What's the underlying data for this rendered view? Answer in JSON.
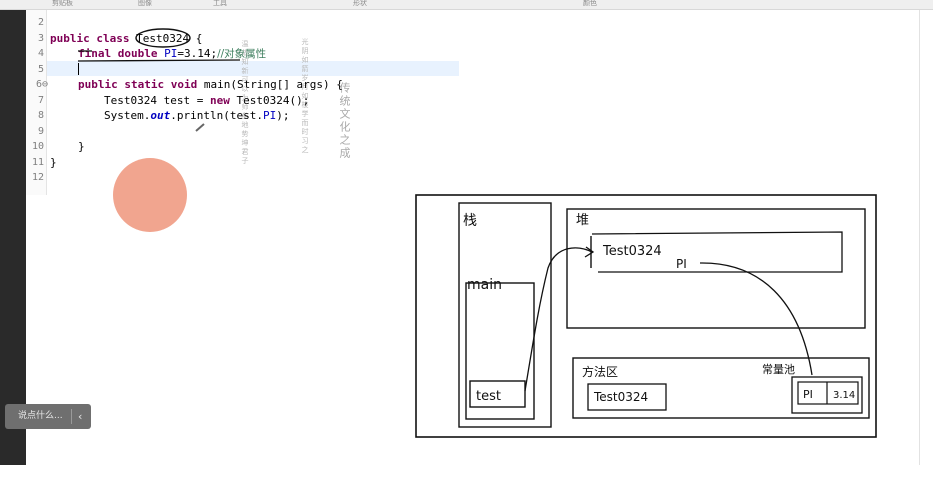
{
  "ribbon": {
    "labels": [
      "剪贴板",
      "图像",
      "工具",
      "形状",
      "颜色"
    ]
  },
  "editor": {
    "line_numbers": [
      "2",
      "3",
      "4",
      "5",
      "6⊖",
      "7",
      "8",
      "9",
      "10",
      "11",
      "12"
    ],
    "code": {
      "l3_kw": "public class ",
      "l3_rest": "Test0324 {",
      "l4_kw": "final double ",
      "l4_field": "PI",
      "l4_rest": "=3.14;",
      "l4_comment": "//对象属性",
      "l6_kw": "public static void ",
      "l6_rest": "main(String[] args) {",
      "l7_a": "Test0324 test = ",
      "l7_kw": "new ",
      "l7_b": "Test0324();",
      "l8_a": "System.",
      "l8_out": "out",
      "l8_b": ".println(test.",
      "l8_field": "PI",
      "l8_c": ");",
      "l10": "}",
      "l11": "}"
    },
    "watermark": {
      "col1": "传统文化之成",
      "col2": "光阴如箭岁月如梭学而时习之",
      "col3": "温故知新可以为师矣地势坤君子"
    }
  },
  "diagram": {
    "stack_label": "栈",
    "main_label": "main",
    "var_label": "test",
    "heap_label": "堆",
    "object_label": "Test0324",
    "pi_label": "PI",
    "method_area_label": "方法区",
    "class_label": "Test0324",
    "static_label": "常量池",
    "static_pi": "PI",
    "static_value": "3.14"
  },
  "chat_widget": {
    "placeholder": "说点什么...",
    "collapse_icon": "‹"
  }
}
